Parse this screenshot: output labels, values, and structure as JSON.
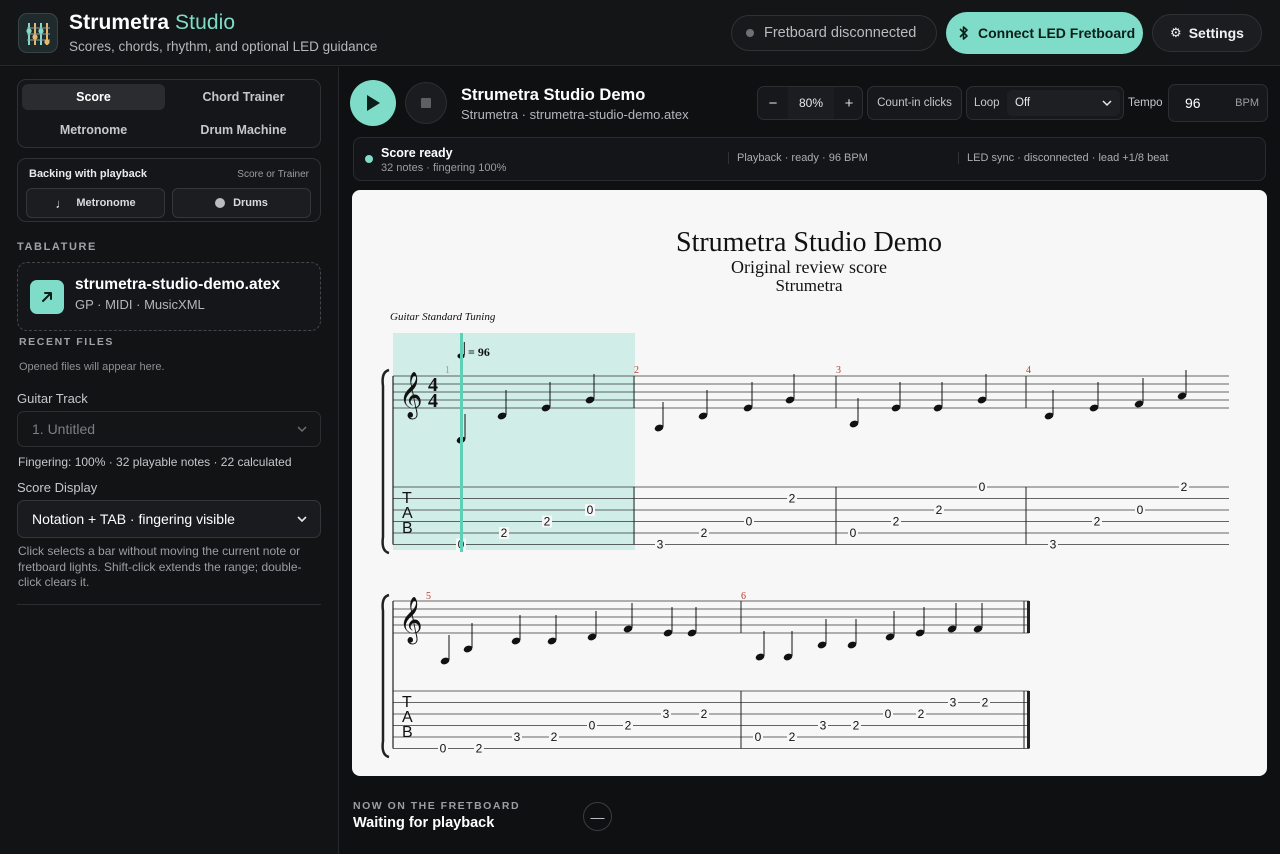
{
  "app": {
    "title_main": "Strumetra",
    "title_accent": "Studio",
    "subtitle": "Scores, chords, rhythm, and optional LED guidance"
  },
  "header": {
    "status": "Fretboard disconnected",
    "connect_label": "Connect LED Fretboard",
    "settings_label": "Settings"
  },
  "sidebar": {
    "modes": [
      "Score",
      "Chord Trainer",
      "Metronome",
      "Drum Machine"
    ],
    "active_mode": "Score",
    "backing": {
      "title": "Backing with playback",
      "hint": "Score or Trainer",
      "metronome_label": "Metronome",
      "drums_label": "Drums"
    },
    "tablature_label": "TABLATURE",
    "file": {
      "name": "strumetra-studio-demo.atex",
      "types": "GP · MIDI · MusicXML"
    },
    "recent_label": "RECENT FILES",
    "recent_empty": "Opened files will appear here.",
    "track_label": "Guitar Track",
    "track_value": "1. Untitled",
    "fingering_info": "Fingering: 100% · 32 playable notes · 22 calculated",
    "display_label": "Score Display",
    "display_value": "Notation + TAB · fingering visible",
    "help": "Click selects a bar without moving the current note or fretboard lights. Shift-click extends the range; double-click clears it."
  },
  "transport": {
    "title": "Strumetra Studio Demo",
    "subtitle": "Strumetra · strumetra-studio-demo.atex",
    "zoom": "80%",
    "count_in": "Count-in clicks",
    "loop_label": "Loop",
    "loop_value": "Off",
    "tempo_label": "Tempo",
    "tempo_value": "96",
    "tempo_unit": "BPM"
  },
  "status": {
    "title": "Score ready",
    "sub": "32 notes · fingering 100%",
    "playback": "Playback · ready · 96 BPM",
    "led": "LED sync · disconnected · lead +1/8 beat"
  },
  "score": {
    "title": "Strumetra Studio Demo",
    "subtitle": "Original review score",
    "artist": "Strumetra",
    "tuning": "Guitar Standard Tuning",
    "tempo_mark": "= 96",
    "measure_numbers": [
      "1",
      "2",
      "3",
      "4",
      "5",
      "6"
    ]
  },
  "now": {
    "label": "NOW ON THE FRETBOARD",
    "value": "Waiting for playback",
    "dash": "—"
  },
  "colors": {
    "accent": "#7fdcc8",
    "background": "#0f1012",
    "measure_number": "#c0392b"
  }
}
